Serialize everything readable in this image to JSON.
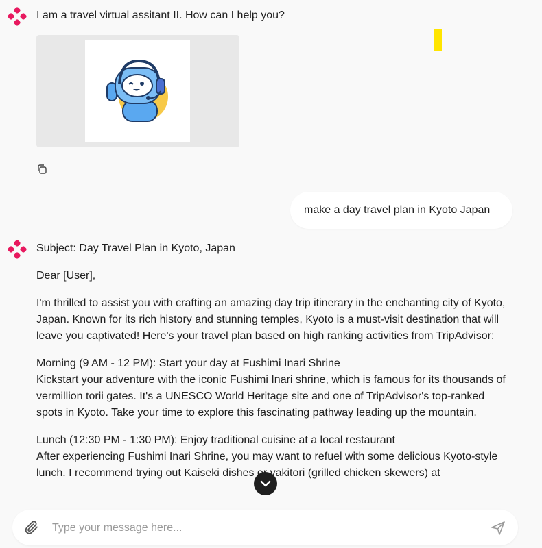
{
  "messages": {
    "bot_greeting": "I am a travel virtual assitant II. How can I help you?",
    "user_prompt": "make a day travel plan in Kyoto Japan",
    "reply": {
      "subject": "Subject: Day Travel Plan in Kyoto, Japan",
      "salutation": "Dear [User],",
      "intro": "I'm thrilled to assist you with crafting an amazing day trip itinerary in the enchanting city of Kyoto, Japan. Known for its rich history and stunning temples, Kyoto is a must-visit destination that will leave you captivated! Here's your travel plan based on high ranking activities from TripAdvisor:",
      "morning_title": "Morning (9 AM - 12 PM): Start your day at Fushimi Inari Shrine",
      "morning_body": "Kickstart your adventure with the iconic Fushimi Inari shrine, which is famous for its thousands of vermillion torii gates. It's a UNESCO World Heritage site and one of TripAdvisor's top-ranked spots in Kyoto. Take your time to explore this fascinating pathway leading up the mountain.",
      "lunch_title": "Lunch (12:30 PM - 1:30 PM): Enjoy traditional cuisine at a local restaurant",
      "lunch_body": "After experiencing Fushimi Inari Shrine, you may want to refuel with some delicious Kyoto-style lunch. I recommend trying out Kaiseki dishes or yakitori (grilled chicken skewers) at"
    }
  },
  "input": {
    "placeholder": "Type your message here...",
    "value": ""
  },
  "icons": {
    "bot_avatar": "four-petal-logo-icon",
    "copy": "copy-icon",
    "scroll_down": "chevron-down-icon",
    "attach": "paperclip-icon",
    "send": "send-icon"
  },
  "colors": {
    "brand": "#e8195f",
    "background": "#f9f9f9",
    "bubble": "#ffffff",
    "highlight": "#ffe500"
  }
}
